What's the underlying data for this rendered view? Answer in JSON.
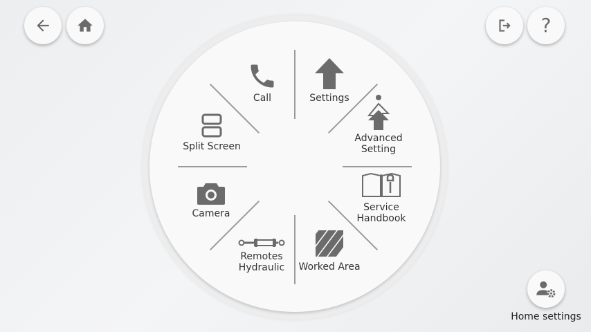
{
  "nav": {
    "back_icon": "arrow-left-icon",
    "home_icon": "home-icon",
    "logout_icon": "logout-icon",
    "help_icon": "question-mark-icon",
    "help_glyph": "?"
  },
  "menu": {
    "call": "Call",
    "settings": "Settings",
    "advanced_setting_line1": "Advanced",
    "advanced_setting_line2": "Setting",
    "split_screen": "Split Screen",
    "service_handbook_line1": "Service",
    "service_handbook_line2": "Handbook",
    "camera": "Camera",
    "remotes_hydraulic_line1": "Remotes",
    "remotes_hydraulic_line2": "Hydraulic",
    "worked_area": "Worked Area"
  },
  "home_settings": {
    "label": "Home settings",
    "icon": "user-gear-icon"
  },
  "colors": {
    "icon": "#6b6b6b",
    "text": "#333333"
  }
}
